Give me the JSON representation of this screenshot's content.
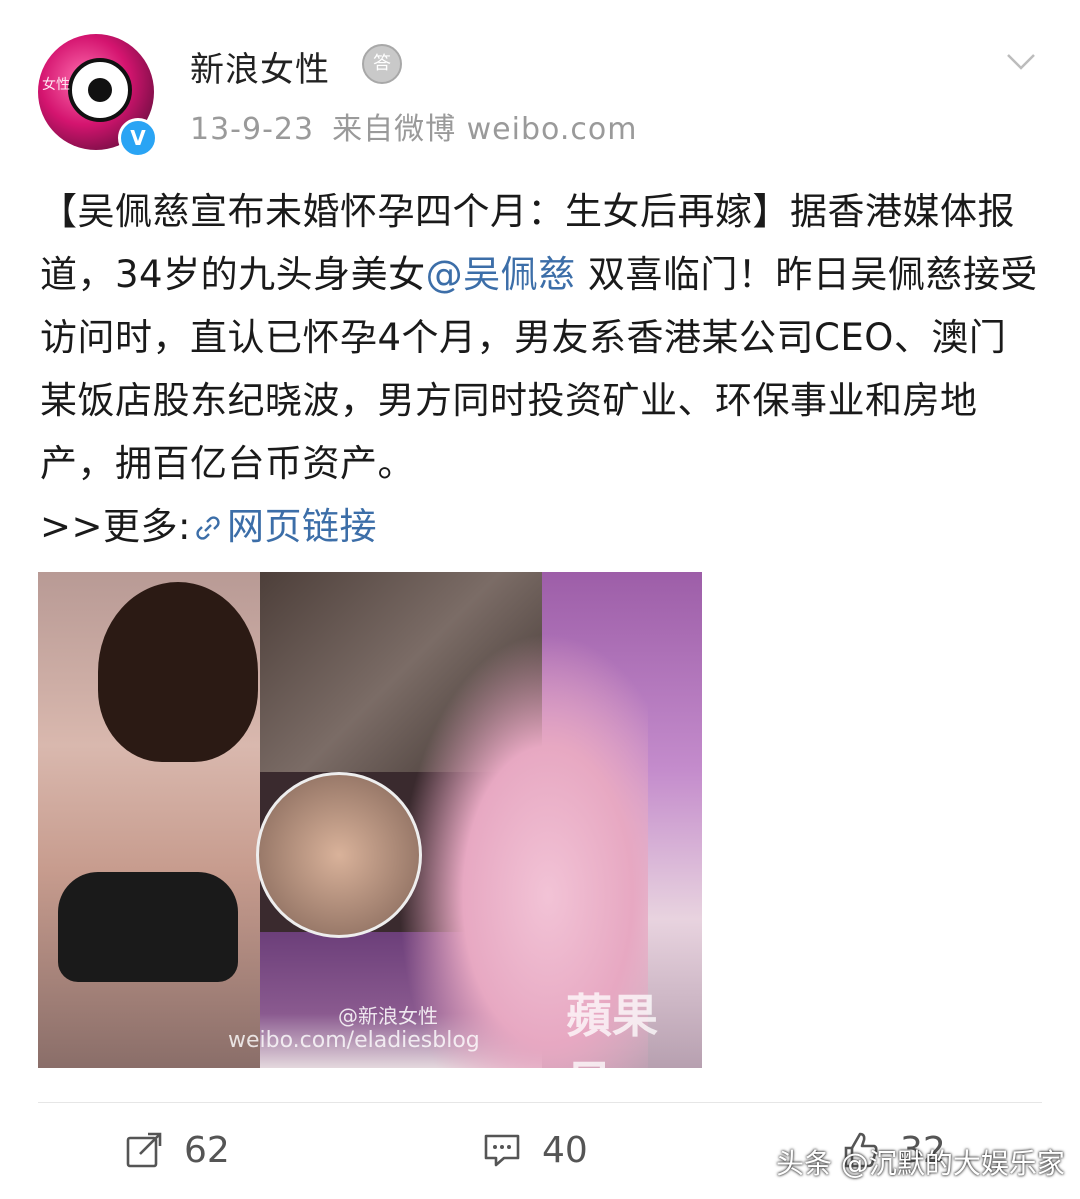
{
  "post": {
    "author": "新浪女性",
    "avatar_label": "女性",
    "verified_badge": "V",
    "medal_label": "答",
    "date": "13-9-23",
    "source": "来自微博 weibo.com",
    "content": {
      "headline": "【吴佩慈宣布未婚怀孕四个月：生女后再嫁】",
      "text1": "据香港媒体报道，34岁的九头身美女",
      "mention": "@吴佩慈",
      "text2": " 双喜临门！昨日吴佩慈接受访问时，直认已怀孕4个月，男友系香港某公司CEO、澳门某饭店股东纪晓波，男方同时投资矿业、环保事业和房地产，拥百亿台币资产。",
      "more_prefix": ">>更多:",
      "link_label": "网页链接"
    },
    "image": {
      "watermark_account": "@新浪女性",
      "watermark_url": "weibo.com/eladiesblog",
      "watermark_brand": "蘋果日"
    }
  },
  "actions": {
    "repost_count": "62",
    "comment_count": "40",
    "like_count": "32"
  },
  "footer_watermark": "头条 @沉默的大娱乐家",
  "icons": [
    "chevron-down-icon",
    "link-icon",
    "share-icon",
    "comment-icon",
    "like-icon",
    "verified-icon",
    "medal-icon"
  ]
}
